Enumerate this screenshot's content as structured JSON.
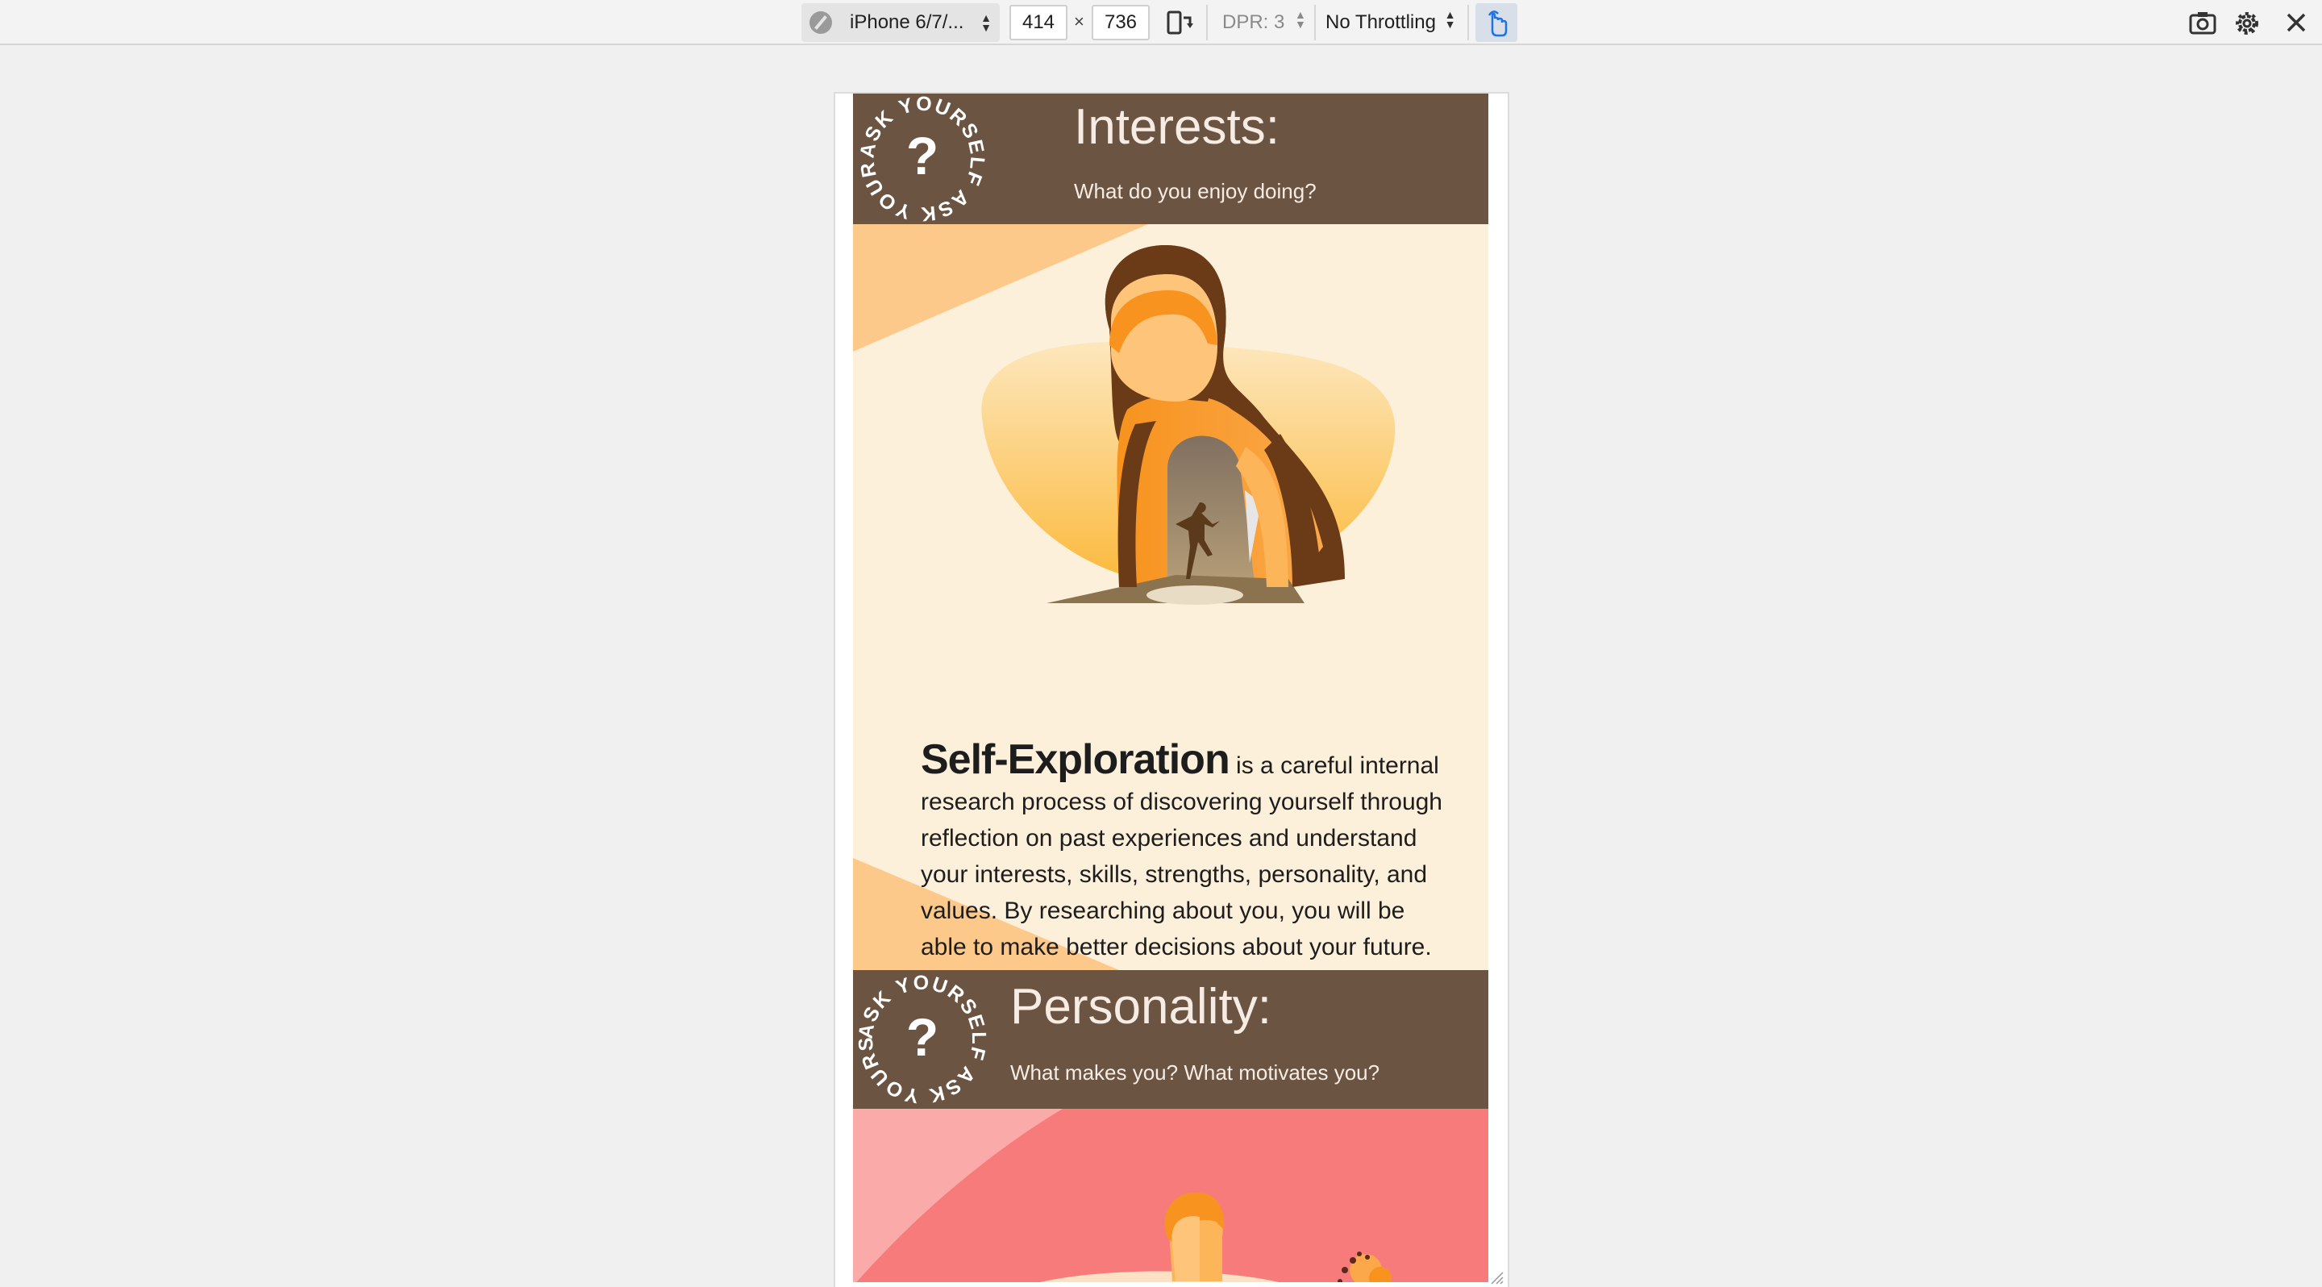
{
  "toolbar": {
    "device_name": "iPhone 6/7/...",
    "width_value": "414",
    "times_sign": "×",
    "height_value": "736",
    "dpr_label": "DPR: 3",
    "throttling_label": "No Throttling"
  },
  "page": {
    "badge_text": "ASK YOURSELF ASK YOURSELF",
    "badge_mark": "?",
    "interests": {
      "title": "Interests:",
      "subtitle": "What do you enjoy doing?"
    },
    "exploration": {
      "lead": "Self-Exploration",
      "body": " is a careful internal research process of discovering yourself through reflection on past experiences and understand your interests, skills, strengths, personality, and values. By researching about you, you will be able to make better decisions about your future."
    },
    "personality": {
      "title": "Personality:",
      "subtitle": "What makes you? What motivates you?"
    }
  },
  "colors": {
    "banner": "#6b5442",
    "section_bg": "#fdf0db",
    "accent_orange": "#f7931e",
    "section2_bg": "#f87b7b"
  }
}
